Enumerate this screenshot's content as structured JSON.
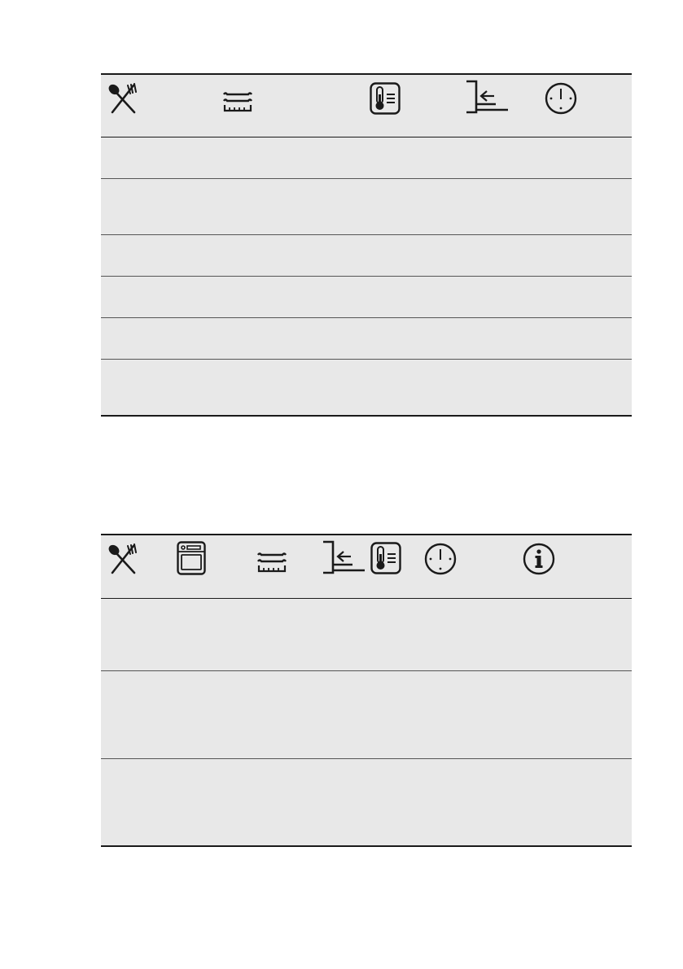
{
  "tables": [
    {
      "header_icons": [
        "cutlery-icon",
        "grill-tray-icon",
        "temperature-icon",
        "shelf-level-icon",
        "clock-icon"
      ],
      "rows": [
        [],
        [],
        [],
        [],
        [],
        []
      ]
    },
    {
      "header_icons": [
        "cutlery-icon",
        "oven-icon",
        "grill-tray-icon",
        "shelf-level-icon",
        "temperature-icon",
        "clock-icon",
        "info-icon"
      ],
      "rows": [
        [],
        [],
        []
      ]
    }
  ],
  "colors": {
    "line": "#1a1a1a",
    "row_bg": "#e8e8e8",
    "page_bg": "#ffffff"
  }
}
